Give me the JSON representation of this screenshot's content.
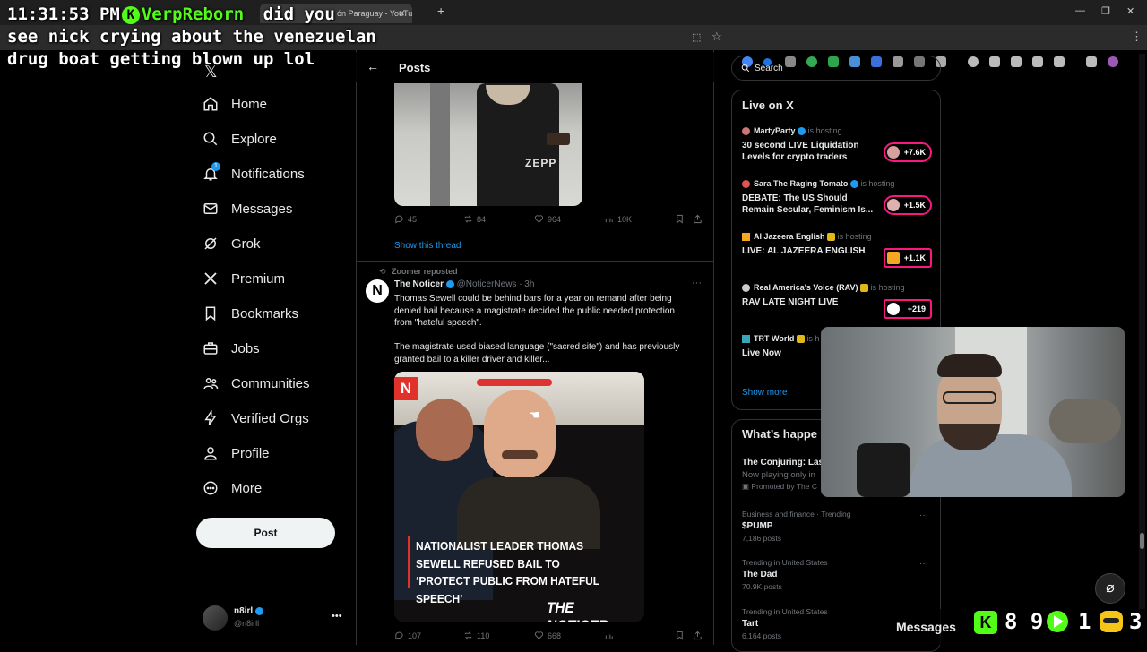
{
  "browser": {
    "tab_title": "ón Paraguay - YouTube",
    "new_tab": "+"
  },
  "overlay": {
    "time": "11:31:53 PM",
    "user": "VerpReborn",
    "message_line1": "did you",
    "message_line2": "see nick crying about the venezuelan",
    "message_line3": "drug boat getting blown up lol",
    "bottom_messages_label": "Messages",
    "kick_count": "8 9",
    "play_count": "1",
    "emote_count": "3"
  },
  "nav": {
    "items": [
      {
        "label": "Home",
        "icon": "home-icon"
      },
      {
        "label": "Explore",
        "icon": "search-icon"
      },
      {
        "label": "Notifications",
        "icon": "bell-icon",
        "badge": "1"
      },
      {
        "label": "Messages",
        "icon": "mail-icon"
      },
      {
        "label": "Grok",
        "icon": "grok-icon"
      },
      {
        "label": "Premium",
        "icon": "x-icon"
      },
      {
        "label": "Bookmarks",
        "icon": "bookmark-icon"
      },
      {
        "label": "Jobs",
        "icon": "briefcase-icon"
      },
      {
        "label": "Communities",
        "icon": "people-icon"
      },
      {
        "label": "Verified Orgs",
        "icon": "lightning-icon"
      },
      {
        "label": "Profile",
        "icon": "person-icon"
      },
      {
        "label": "More",
        "icon": "more-circle-icon"
      }
    ],
    "post_label": "Post",
    "account_name": "n8irl",
    "account_handle": "@n8irll"
  },
  "center": {
    "header_title": "Posts",
    "tweet1": {
      "image_text": "ZEPP",
      "replies": "45",
      "reposts": "84",
      "likes": "964",
      "views": "10K",
      "show_thread": "Show this thread"
    },
    "tweet2": {
      "repost_note": "Zoomer reposted",
      "author": "The Noticer",
      "handle": "@NoticerNews · 3h",
      "avatar_letter": "N",
      "text1": "Thomas Sewell could be behind bars for a year on remand after being denied bail because a magistrate decided the public needed protection from \"hateful speech\".",
      "text2": "The magistrate used biased language (\"sacred site\") and has previously granted bail to a killer driver and killer...",
      "image_logo": "N",
      "headline": "NATIONALIST LEADER THOMAS SEWELL REFUSED BAIL TO ‘PROTECT PUBLIC FROM HATEFUL SPEECH’",
      "brand": "THE NOTICER",
      "replies": "107",
      "reposts": "110",
      "likes": "668"
    }
  },
  "right": {
    "search_placeholder": "Search",
    "live_title": "Live on X",
    "live": [
      {
        "host": "MartyParty",
        "hosting": "is hosting",
        "title": "30 second LIVE Liquidation Levels for crypto traders",
        "count": "+7.6K"
      },
      {
        "host": "Sara The Raging Tomato",
        "hosting": "is hosting",
        "title": "DEBATE: The US Should Remain Secular, Feminism Is...",
        "count": "+1.5K"
      },
      {
        "host": "Al Jazeera English",
        "hosting": "is hosting",
        "title": "LIVE: AL JAZEERA ENGLISH",
        "count": "+1.1K"
      },
      {
        "host": "Real America's Voice (RAV)",
        "hosting": "is hosting",
        "title": "RAV LATE NIGHT LIVE",
        "count": "+219"
      },
      {
        "host": "TRT World",
        "hosting": "is h",
        "title": "Live Now",
        "count": ""
      }
    ],
    "show_more": "Show more",
    "happening_title": "What’s happe",
    "promoted": {
      "title": "The Conjuring: Las",
      "sub": "Now playing only in",
      "promo": "Promoted by The C"
    },
    "trends": [
      {
        "context": "Business and finance · Trending",
        "name": "$PUMP",
        "posts": "7,186 posts"
      },
      {
        "context": "Trending in United States",
        "name": "The Dad",
        "posts": "70.9K posts"
      },
      {
        "context": "Trending in United States",
        "name": "Tart",
        "posts": "6,164 posts"
      }
    ]
  },
  "colors": {
    "accent": "#1d9bf0",
    "live_pink": "#f91880",
    "kick_green": "#53fc18"
  }
}
